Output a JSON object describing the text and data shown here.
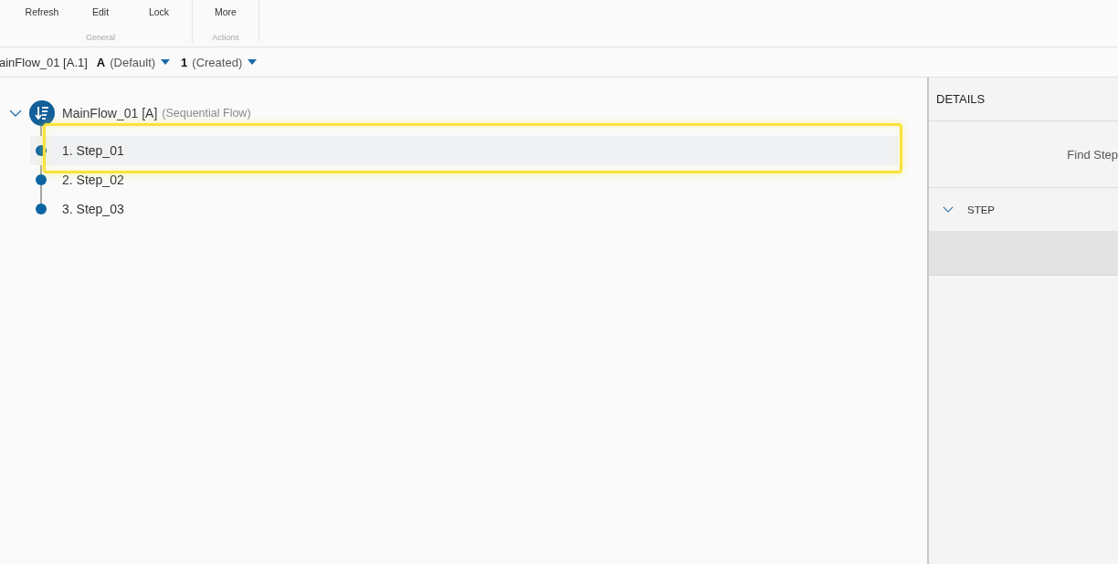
{
  "ribbon": {
    "groups": [
      {
        "label": "General",
        "buttons": [
          "Refresh",
          "Edit",
          "Lock"
        ]
      },
      {
        "label": "Actions",
        "buttons": [
          "More"
        ]
      }
    ]
  },
  "breadcrumb": {
    "path": "ainFlow_01 [A.1]",
    "selectors": [
      {
        "value": "A",
        "note": "(Default)"
      },
      {
        "value": "1",
        "note": "(Created)"
      }
    ]
  },
  "tree": {
    "flow": {
      "name": "MainFlow_01 [A]",
      "type": "(Sequential Flow)",
      "expanded": true,
      "steps": [
        {
          "label": "1. Step_01",
          "selected": true,
          "highlighted": true
        },
        {
          "label": "2. Step_02",
          "selected": false,
          "highlighted": false
        },
        {
          "label": "3. Step_03",
          "selected": false,
          "highlighted": false
        }
      ]
    }
  },
  "details": {
    "title": "DETAILS",
    "find_step": "Find Step",
    "sections": [
      {
        "label": "STEP",
        "expanded": true
      }
    ]
  }
}
